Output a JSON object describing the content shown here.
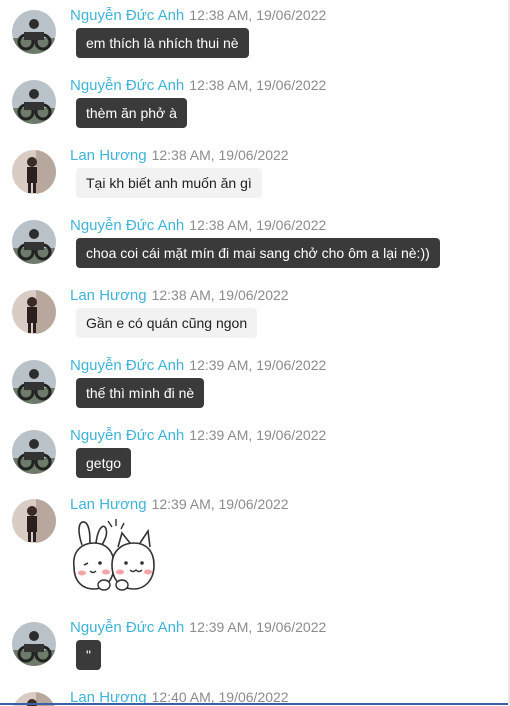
{
  "messages": [
    {
      "sender": "Nguyễn Đức Anh",
      "time": "12:38 AM, 19/06/2022",
      "text": "em thích là nhích thui nè",
      "self": true
    },
    {
      "sender": "Nguyễn Đức Anh",
      "time": "12:38 AM, 19/06/2022",
      "text": "thèm ăn phở à",
      "self": true
    },
    {
      "sender": "Lan Hương",
      "time": "12:38 AM, 19/06/2022",
      "text": "Tại kh biết anh muốn ăn gì",
      "self": false
    },
    {
      "sender": "Nguyễn Đức Anh",
      "time": "12:38 AM, 19/06/2022",
      "text": "choa coi cái mặt mín đi mai sang chở cho ôm a lại nè:))",
      "self": true
    },
    {
      "sender": "Lan Hương",
      "time": "12:38 AM, 19/06/2022",
      "text": "Gần e có quán cũng ngon",
      "self": false
    },
    {
      "sender": "Nguyễn Đức Anh",
      "time": "12:39 AM, 19/06/2022",
      "text": "thế thì mình đi nè",
      "self": true
    },
    {
      "sender": "Nguyễn Đức Anh",
      "time": "12:39 AM, 19/06/2022",
      "text": "getgo",
      "self": true
    },
    {
      "sender": "Lan Hương",
      "time": "12:39 AM, 19/06/2022",
      "sticker": "bunny-cat-sticker",
      "self": false
    },
    {
      "sender": "Nguyễn Đức Anh",
      "time": "12:39 AM, 19/06/2022",
      "text": "\"",
      "self": true
    },
    {
      "sender": "Lan Hương",
      "time": "12:40 AM, 19/06/2022",
      "self": false
    }
  ],
  "colors": {
    "sender": "#3fb3d8",
    "time": "#8c8c8c",
    "bubble_self": "#3a3a3a",
    "bubble_other": "#f2f2f2"
  }
}
